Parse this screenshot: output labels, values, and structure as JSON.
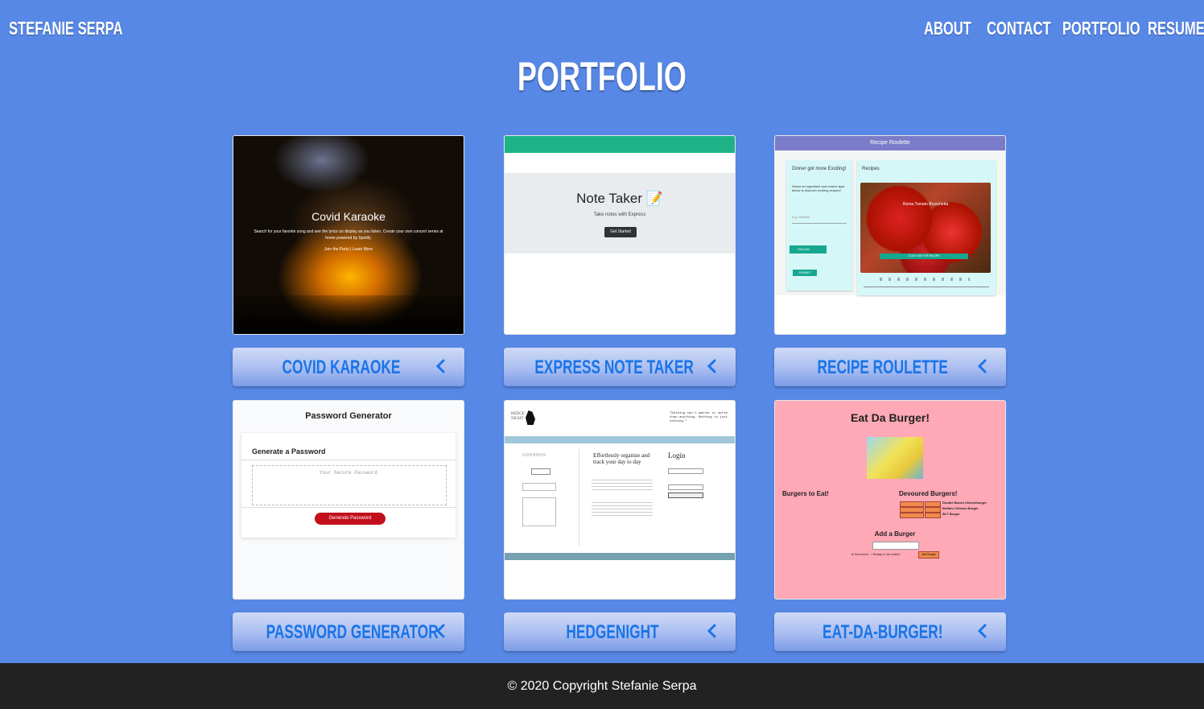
{
  "brand": "STEFANIE SERPA",
  "nav": [
    {
      "label": "ABOUT"
    },
    {
      "label": "CONTACT"
    },
    {
      "label": "PORTFOLIO"
    },
    {
      "label": "RESUME"
    }
  ],
  "page_title": "PORTFOLIO",
  "projects": [
    {
      "button_label": "COVID KARAOKE",
      "thumb": {
        "title": "Covid Karaoke",
        "text": "Search for your favorite song and see the lyrics on display as you listen. Create your own concert series at home powered by Spotify.",
        "links": "Join the Party  |  Learn More"
      }
    },
    {
      "button_label": "EXPRESS NOTE TAKER",
      "thumb": {
        "title": "Note Taker 📝",
        "subtitle": "Take notes with Express",
        "button": "Get Started"
      }
    },
    {
      "button_label": "RECIPE ROULETTE",
      "thumb": {
        "header": "Recipe Roulette",
        "left_title": "Dinner got more Exciting!",
        "left_text": "Select an ingredient and cuisine type below to discover exciting recipes!",
        "ingredient_placeholder": "e.g. Chicken",
        "cuisine_value": "ITALIAN",
        "submit": "SUBMIT",
        "recipes_title": "Recipes",
        "image_caption": "Roma Tomato Bruschetta",
        "image_button": "CLICK ME FOR RECIPE"
      }
    },
    {
      "button_label": "PASSWORD GENERATOR",
      "thumb": {
        "title": "Password Generator",
        "card_title": "Generate a Password",
        "placeholder": "Your Secure Password",
        "button": "Generate Password"
      }
    },
    {
      "button_label": "HEDGENIGHT",
      "thumb": {
        "quote": "\"Nothing can't matter or worse than anything. Nothing is just nothing.\"",
        "headline": "Effortlessly organize and track your day to day",
        "login": "Login"
      }
    },
    {
      "button_label": "EAT-DA-BURGER!",
      "thumb": {
        "title": "Eat Da Burger!",
        "left_title": "Burgers to Eat!",
        "right_title": "Devoured Burgers!",
        "burgers": [
          "Double Bacon Cheeseburger",
          "Buffalo Chicken Burger",
          "BLT Burger"
        ],
        "add_title": "Add a Burger",
        "add_button": "Add Burger"
      }
    }
  ],
  "footer": "© 2020 Copyright Stefanie Serpa"
}
